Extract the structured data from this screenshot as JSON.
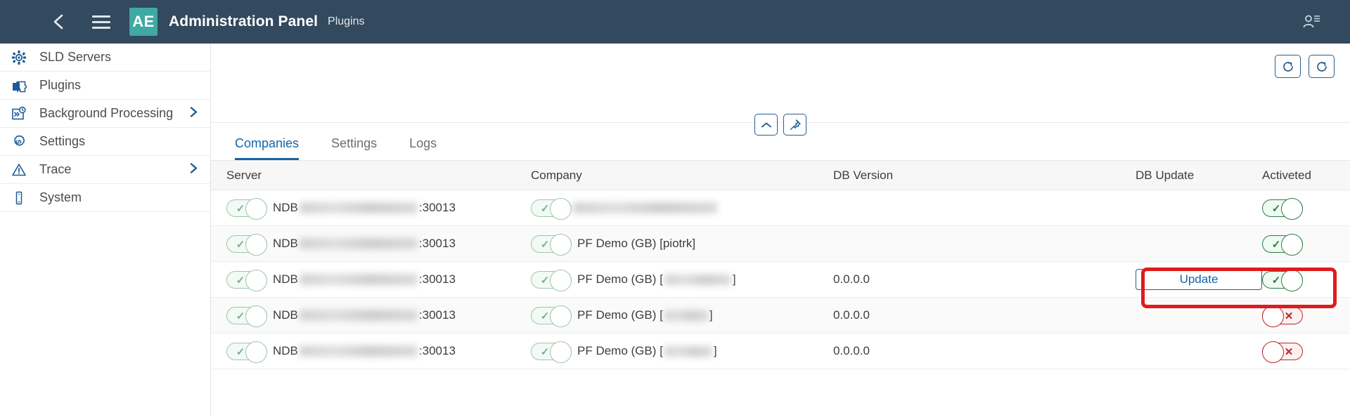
{
  "topbar": {
    "back_icon": "chevron-left-icon",
    "menu_icon": "hamburger-menu-icon",
    "logo_text": "AE",
    "title": "Administration Panel",
    "subtitle": "Plugins",
    "user_icon": "user-account-icon"
  },
  "sidebar": {
    "items": [
      {
        "label": "SLD Servers",
        "icon": "sld-servers-icon",
        "expandable": false
      },
      {
        "label": "Plugins",
        "icon": "plugins-puzzle-icon",
        "expandable": false
      },
      {
        "label": "Background Processing",
        "icon": "background-processing-icon",
        "expandable": true
      },
      {
        "label": "Settings",
        "icon": "settings-gear-icon",
        "expandable": false
      },
      {
        "label": "Trace",
        "icon": "trace-warning-icon",
        "expandable": true
      },
      {
        "label": "System",
        "icon": "system-device-icon",
        "expandable": false
      }
    ]
  },
  "toolbar": {
    "refresh_label": "refresh-icon",
    "reload_label": "reload-icon",
    "collapse_label": "chevron-up-icon",
    "pin_label": "pin-icon"
  },
  "tabs": [
    {
      "label": "Companies",
      "active": true
    },
    {
      "label": "Settings",
      "active": false
    },
    {
      "label": "Logs",
      "active": false
    }
  ],
  "table": {
    "headers": {
      "server": "Server",
      "company": "Company",
      "db_version": "DB Version",
      "db_update": "DB Update",
      "activated": "Activeted"
    },
    "rows": [
      {
        "server_prefix": "NDB",
        "server_redacted": true,
        "server_suffix": ":30013",
        "server_toggle": "on",
        "company_toggle": "on-muted",
        "company_text": "",
        "company_redacted": true,
        "db_version": "",
        "db_update": "",
        "activated_toggle": "on"
      },
      {
        "server_prefix": "NDB",
        "server_redacted": true,
        "server_suffix": ":30013",
        "server_toggle": "on",
        "company_toggle": "on-muted",
        "company_text": "PF Demo (GB) [piotrk]",
        "company_redacted": false,
        "db_version": "",
        "db_update": "",
        "activated_toggle": "on"
      },
      {
        "server_prefix": "NDB",
        "server_redacted": true,
        "server_suffix": ":30013",
        "server_toggle": "on",
        "company_toggle": "on-muted",
        "company_text": "PF Demo (GB) [",
        "company_text_tail": "]",
        "company_redacted": true,
        "db_version": "0.0.0.0",
        "db_update": "Update",
        "activated_toggle": "on"
      },
      {
        "server_prefix": "NDB",
        "server_redacted": true,
        "server_suffix": ":30013",
        "server_toggle": "on",
        "company_toggle": "on-muted",
        "company_text": "PF Demo (GB) [",
        "company_text_tail": "]",
        "company_redacted": true,
        "db_version": "0.0.0.0",
        "db_update": "",
        "activated_toggle": "off"
      },
      {
        "server_prefix": "NDB",
        "server_redacted": true,
        "server_suffix": ":30013",
        "server_toggle": "on",
        "company_toggle": "on-muted",
        "company_text": "PF Demo (GB) [",
        "company_text_tail": "]",
        "company_redacted": true,
        "db_version": "0.0.0.0",
        "db_update": "",
        "activated_toggle": "off"
      }
    ]
  },
  "annotation": {
    "highlight_color": "#e01b1b",
    "highlight_target": "Update"
  },
  "glyphs": {
    "check": "✓",
    "cross": "✕"
  },
  "colors": {
    "topbar_bg": "#32495e",
    "logo_bg": "#3fa9a3",
    "accent_blue": "#1565a8",
    "toggle_on": "#2e7d46",
    "toggle_off": "#b62828"
  }
}
